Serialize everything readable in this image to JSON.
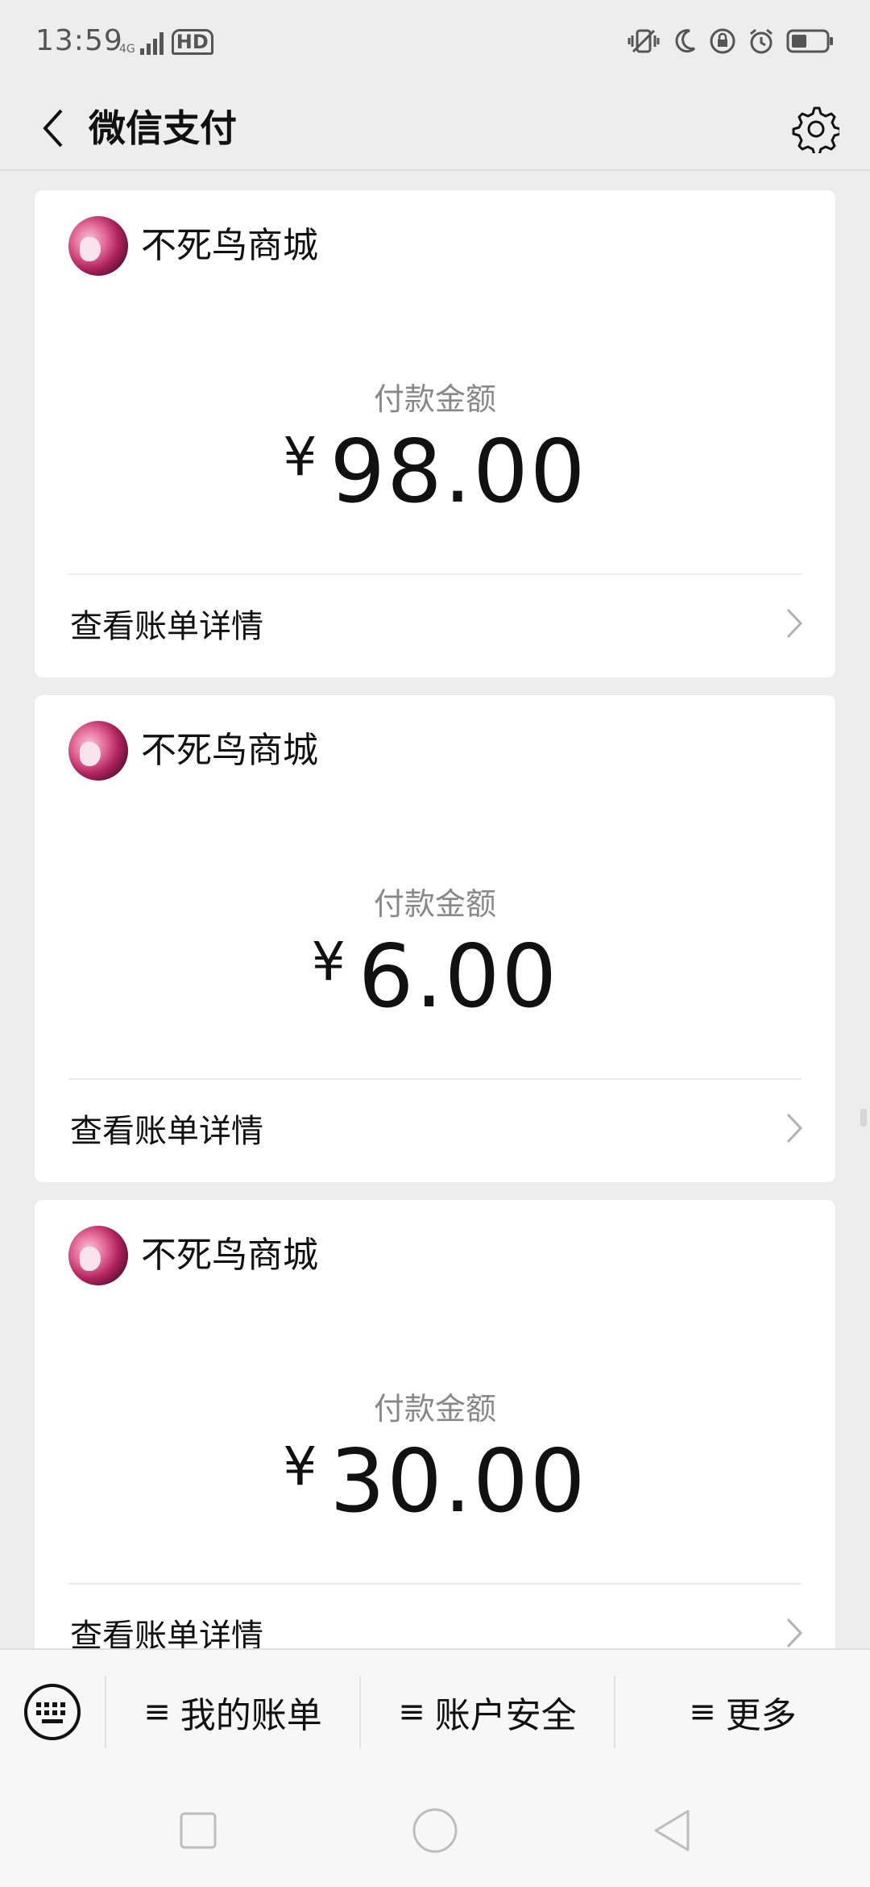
{
  "status_bar": {
    "time": "13:59",
    "net_tiny": "4G",
    "hd": "HD"
  },
  "header": {
    "title": "微信支付",
    "back_icon": "chevron-left-icon",
    "settings_icon": "gear-icon"
  },
  "payments": [
    {
      "merchant": "不死鸟商城",
      "amount_label": "付款金额",
      "currency": "¥",
      "amount": "98.00",
      "detail_label": "查看账单详情"
    },
    {
      "merchant": "不死鸟商城",
      "amount_label": "付款金额",
      "currency": "¥",
      "amount": "6.00",
      "detail_label": "查看账单详情"
    },
    {
      "merchant": "不死鸟商城",
      "amount_label": "付款金额",
      "currency": "¥",
      "amount": "30.00",
      "detail_label": "查看账单详情"
    }
  ],
  "bottom_menu": {
    "keyboard_icon": "keyboard-icon",
    "items": [
      {
        "glyph": "≡",
        "label": "我的账单"
      },
      {
        "glyph": "≡",
        "label": "账户安全"
      },
      {
        "glyph": "≡",
        "label": "更多"
      }
    ]
  },
  "colors": {
    "background": "#ededed",
    "card": "#ffffff",
    "muted_text": "#888888",
    "primary_text": "#111111"
  }
}
